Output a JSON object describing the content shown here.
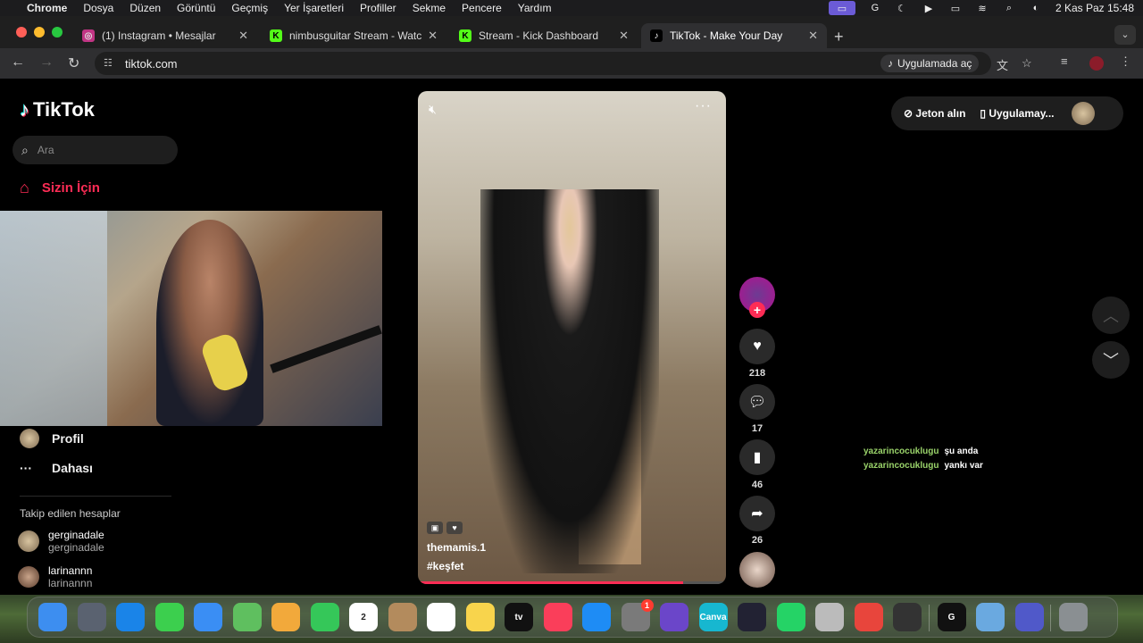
{
  "menubar": {
    "app_name": "Chrome",
    "items": [
      "Dosya",
      "Düzen",
      "Görüntü",
      "Geçmiş",
      "Yer İşaretleri",
      "Profiller",
      "Sekme",
      "Pencere",
      "Yardım"
    ],
    "datetime": "2 Kas Paz  15:48"
  },
  "tabs": [
    {
      "title": "(1) Instagram • Mesajlar",
      "favicon": "instagram-icon",
      "color": "#c13584"
    },
    {
      "title": "nimbusguitar Stream - Watch",
      "favicon": "kick-icon",
      "color": "#53fc18"
    },
    {
      "title": "Stream - Kick Dashboard",
      "favicon": "kick-icon",
      "color": "#53fc18"
    },
    {
      "title": "TikTok - Make Your Day",
      "favicon": "tiktok-icon",
      "color": "#000000"
    }
  ],
  "address": {
    "url": "tiktok.com",
    "open_in_app": "Uygulamada aç"
  },
  "sidebar": {
    "logo": "TikTok",
    "search_placeholder": "Ara",
    "for_you": "Sizin İçin",
    "profile": "Profil",
    "more": "Dahası",
    "following_title": "Takip edilen hesaplar",
    "following": [
      {
        "name": "gerginadale",
        "handle": "gerginadale"
      },
      {
        "name": "larinannn",
        "handle": "larinannn"
      }
    ]
  },
  "video": {
    "author": "themamis.1",
    "hashtag": "#keşfet",
    "progress": 0.86
  },
  "actions": {
    "likes": "218",
    "comments": "17",
    "saves": "46",
    "shares": "26"
  },
  "header_right": {
    "coins": "Jeton alın",
    "app": "Uygulamay..."
  },
  "chat": [
    {
      "user": "yazarincocuklugu",
      "text": "şu anda"
    },
    {
      "user": "yazarincocuklugu",
      "text": "yankı var"
    }
  ],
  "colors": {
    "accent": "#fe2c55",
    "chat_user": "#9ad36a"
  },
  "dock": [
    {
      "name": "Finder",
      "color": "#3d8ef0"
    },
    {
      "name": "Launchpad",
      "color": "#5a6270"
    },
    {
      "name": "Safari",
      "color": "#1a84e8"
    },
    {
      "name": "Messages",
      "color": "#3ccf4e"
    },
    {
      "name": "Mail",
      "color": "#3a8ef4"
    },
    {
      "name": "Maps",
      "color": "#5fbf5f"
    },
    {
      "name": "Photos",
      "color": "#f2a93b"
    },
    {
      "name": "FaceTime",
      "color": "#35c759"
    },
    {
      "name": "Calendar",
      "color": "#ffffff",
      "label": "2"
    },
    {
      "name": "Contacts",
      "color": "#b38b5d"
    },
    {
      "name": "Reminders",
      "color": "#ffffff"
    },
    {
      "name": "Notes",
      "color": "#f8d44c"
    },
    {
      "name": "TV",
      "color": "#111111",
      "label": "tv"
    },
    {
      "name": "Music",
      "color": "#fa3e5a"
    },
    {
      "name": "App Store",
      "color": "#1e8cf5"
    },
    {
      "name": "System Settings",
      "color": "#7a7a7a",
      "badge": "1"
    },
    {
      "name": "iMovie",
      "color": "#6b46c9"
    },
    {
      "name": "Canva",
      "color": "#17b7d0",
      "label": "Canva"
    },
    {
      "name": "OBS",
      "color": "#222233"
    },
    {
      "name": "WhatsApp",
      "color": "#25d366"
    },
    {
      "name": "Disk Utility",
      "color": "#bbbbbb"
    },
    {
      "name": "Chrome",
      "color": "#e8453c"
    },
    {
      "name": "Calculator",
      "color": "#333333"
    },
    {
      "name": "G Hub",
      "color": "#111111",
      "label": "G"
    },
    {
      "name": "Preview",
      "color": "#6aa9e0"
    },
    {
      "name": "Teams",
      "color": "#5059c9"
    },
    {
      "name": "Trash",
      "color": "#8a8f92"
    }
  ]
}
